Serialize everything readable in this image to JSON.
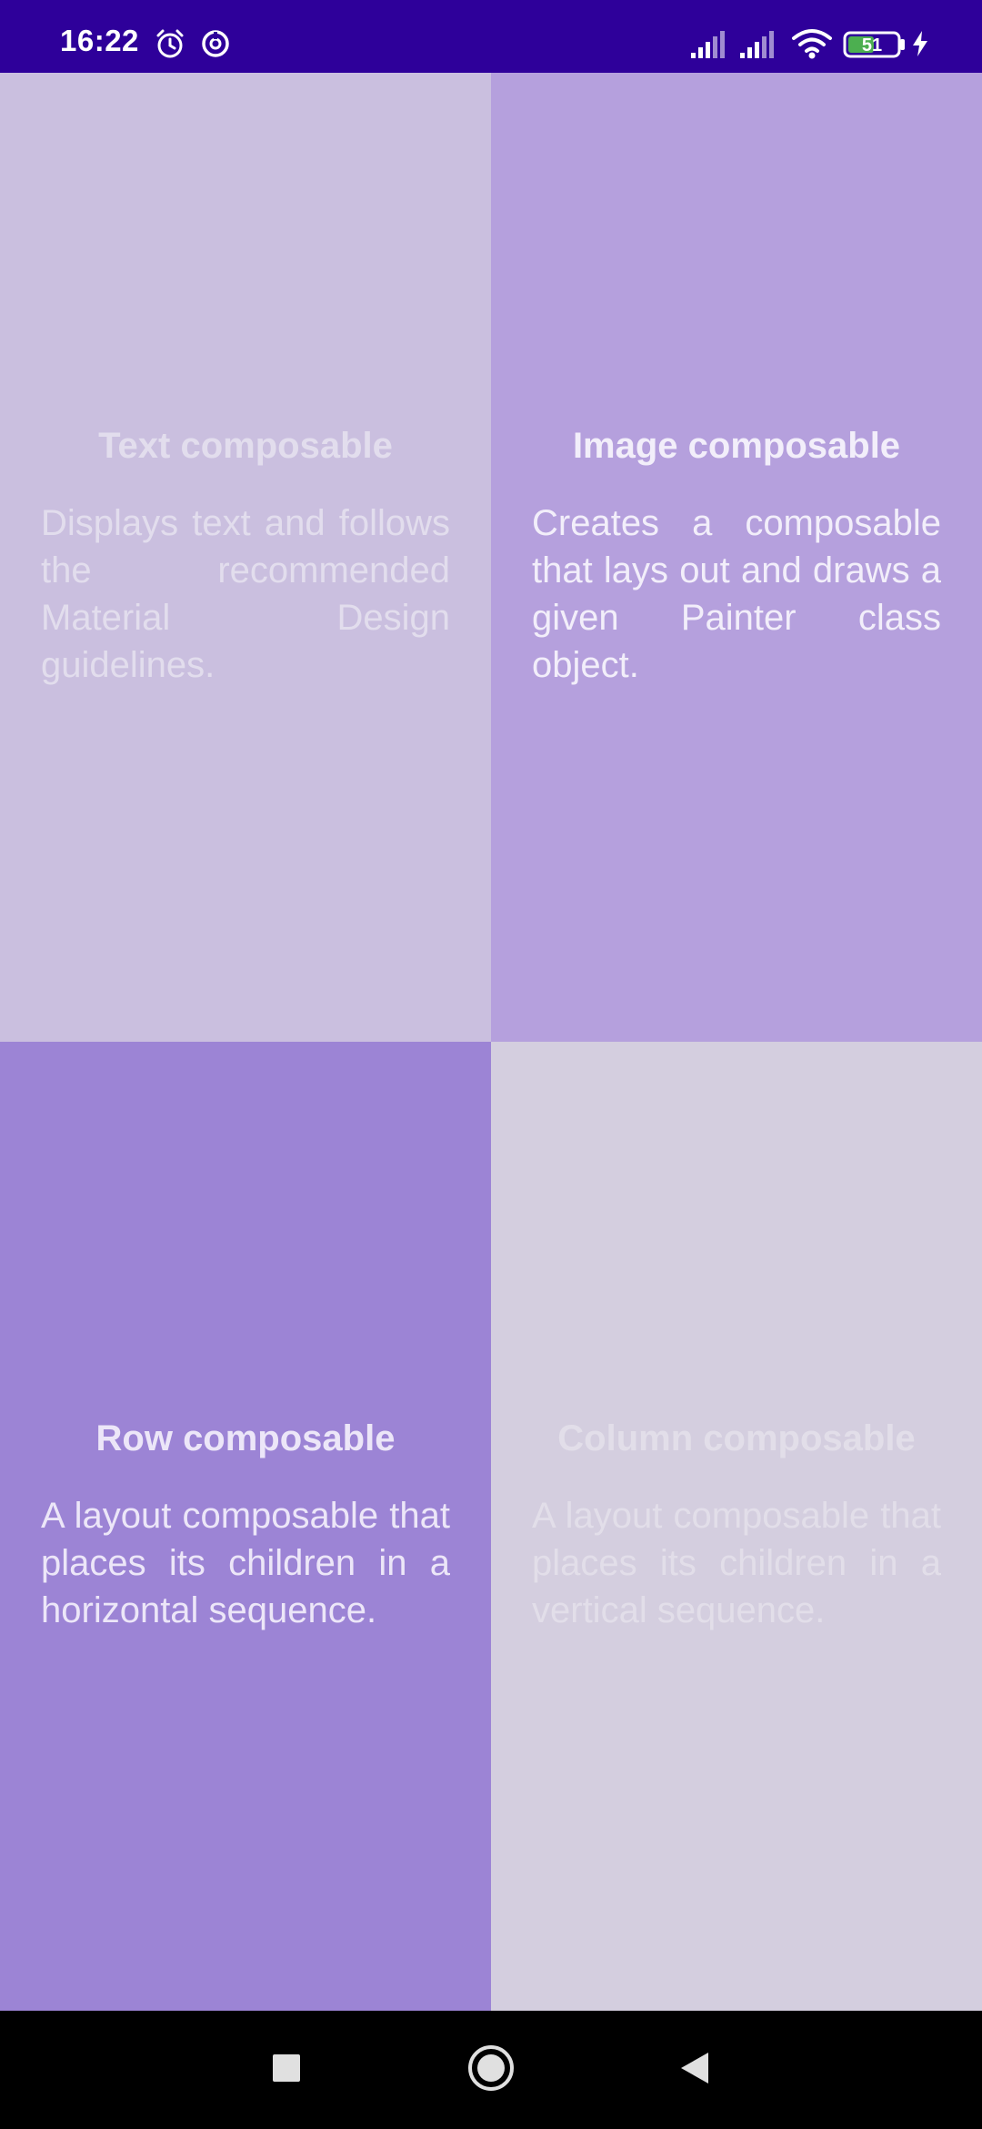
{
  "status_bar": {
    "time": "16:22",
    "battery_level": "51",
    "left_icons": [
      "alarm-icon",
      "data-saver-icon"
    ],
    "right_icons": [
      "signal-sim1-icon",
      "signal-sim2-icon",
      "wifi-icon",
      "battery-icon",
      "charging-icon"
    ]
  },
  "cards": [
    {
      "title": "Text composable",
      "description": "Displays text and follows the recommended Material Design guidelines."
    },
    {
      "title": "Image composable",
      "description": "Creates a composable that lays out and draws a given Painter class object."
    },
    {
      "title": "Row composable",
      "description": "A layout composable that places its children in a horizontal sequence."
    },
    {
      "title": "Column composable",
      "description": "A layout composable that places its children in a vertical sequence."
    }
  ],
  "nav_bar": {
    "buttons": [
      "recents-square-icon",
      "home-circle-icon",
      "back-triangle-icon"
    ]
  },
  "colors": {
    "status_bar": "#2e009a",
    "card_text": "#cabfdf",
    "card_image": "#b5a0dd",
    "card_row": "#9c84d5",
    "card_column": "#d4cedf",
    "nav_bar": "#000000"
  }
}
